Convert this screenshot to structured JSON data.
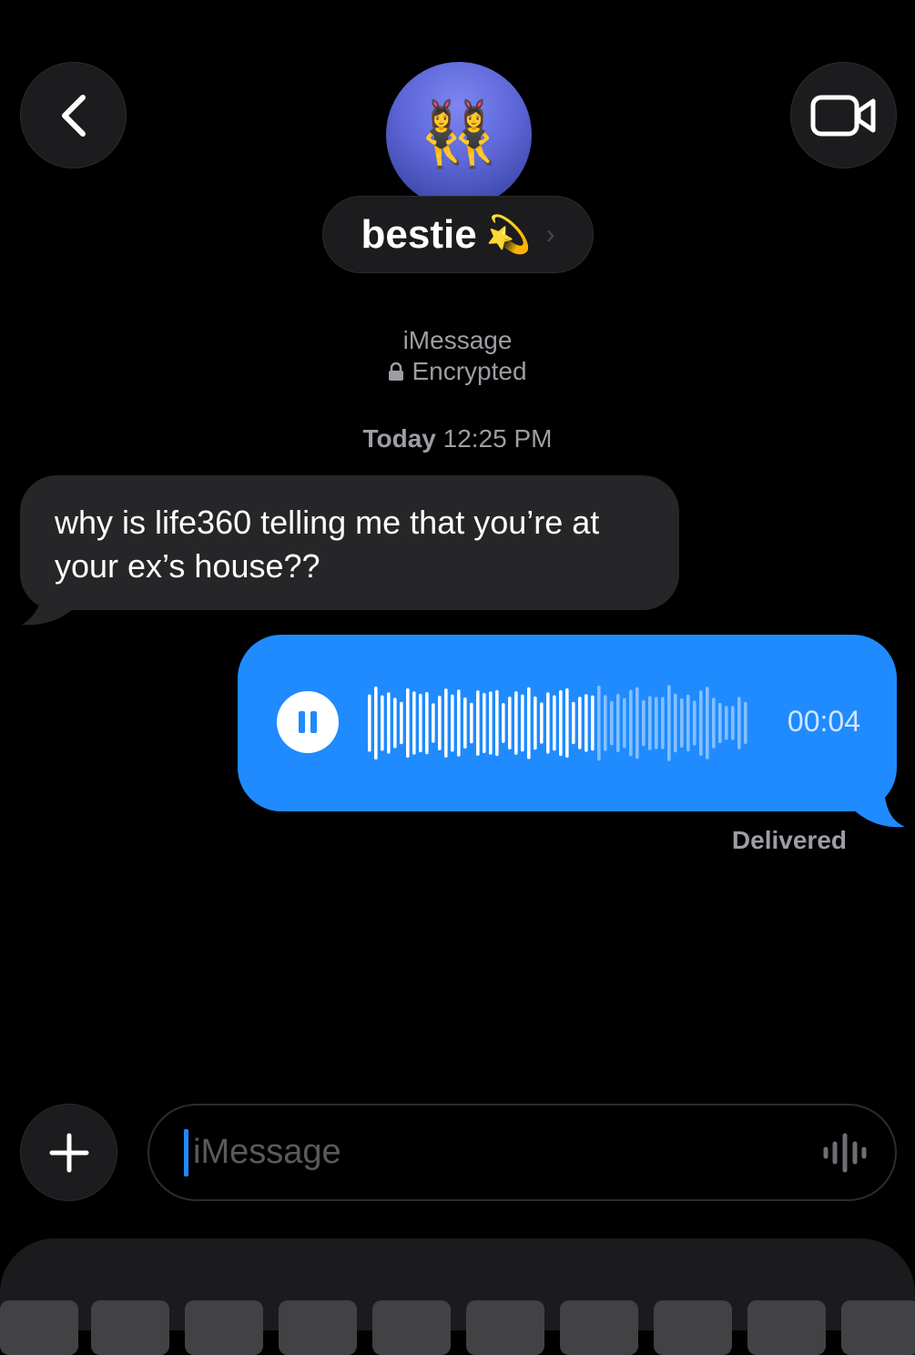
{
  "header": {
    "back_icon": "chevron-left-icon",
    "video_icon": "video-camera-icon",
    "avatar_emoji": "👯‍♀️",
    "contact_name": "bestie",
    "contact_emoji": "💫",
    "chevron": "›"
  },
  "conversation_info": {
    "service": "iMessage",
    "encryption": "Encrypted",
    "day": "Today",
    "time": "12:25 PM"
  },
  "messages": [
    {
      "direction": "incoming",
      "text": "why is life360 telling me that you’re at your ex’s house??"
    },
    {
      "direction": "outgoing",
      "type": "audio",
      "duration": "00:04",
      "playback_progress": 0.6
    }
  ],
  "delivery_status": "Delivered",
  "composer": {
    "placeholder": "iMessage",
    "plus_icon": "plus-icon",
    "dictation_icon": "waveform-icon"
  },
  "colors": {
    "outgoing_bubble": "#1f8bff",
    "incoming_bubble": "#262628",
    "background": "#000000"
  }
}
